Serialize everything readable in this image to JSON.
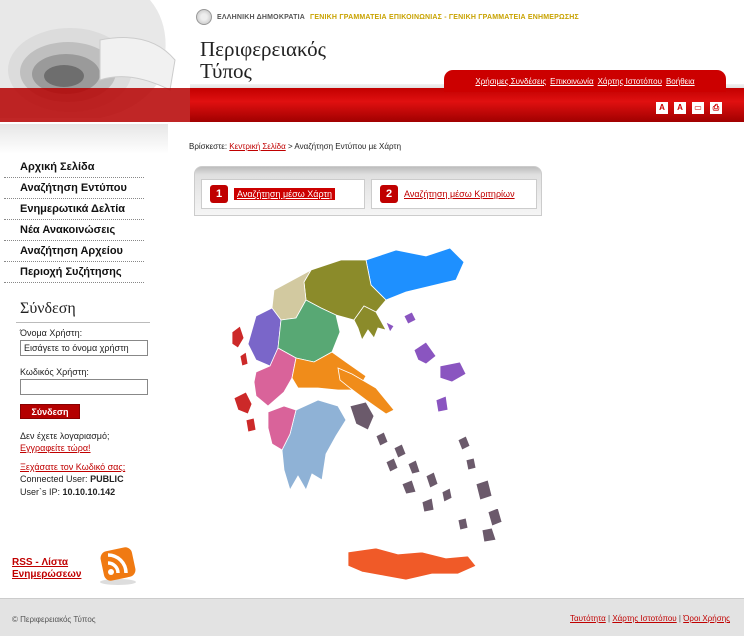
{
  "header": {
    "gov_line_1": "ΕΛΛΗΝΙΚΗ ΔΗΜΟΚΡΑΤΙΑ",
    "gov_line_2": "ΓΕΝΙΚΗ ΓΡΑΜΜΑΤΕΙΑ ΕΠΙΚΟΙΝΩΝΙΑΣ - ΓΕΝΙΚΗ ΓΡΑΜΜΑΤΕΙΑ ΕΝΗΜΕΡΩΣΗΣ",
    "title_line_1": "Περιφερειακός",
    "title_line_2": "Τύπος",
    "top_links": [
      "Χρήσιμες Συνδέσεις",
      "Επικοινωνία",
      "Χάρτης Ιστοτόπου",
      "Βοήθεια"
    ],
    "tools": [
      "A",
      "A",
      "▭",
      "⎙"
    ]
  },
  "sidebar": {
    "menu": [
      "Αρχική Σελίδα",
      "Αναζήτηση Εντύπου",
      "Ενημερωτικά Δελτία",
      "Νέα Ανακοινώσεις",
      "Αναζήτηση Αρχείου",
      "Περιοχή Συζήτησης"
    ],
    "login": {
      "title": "Σύνδεση",
      "username_label": "Όνομα Χρήστη:",
      "username_value": "Εισάγετε το όνομα χρήστη",
      "password_label": "Κωδικός Χρήστη:",
      "password_value": "",
      "button": "Σύνδεση",
      "no_account": "Δεν έχετε λογαριασμό;",
      "register": "Εγγραφείτε τώρα!",
      "forgot": "Ξεχάσατε τον Κωδικό σας;",
      "connected_label": "Connected User:",
      "connected_value": "PUBLIC",
      "ip_label": "User`s IP:",
      "ip_value": "10.10.10.142"
    },
    "rss_line_1": "RSS - Λίστα",
    "rss_line_2": "Ενημερώσεων"
  },
  "main": {
    "breadcrumb_prefix": "Βρίσκεστε:",
    "breadcrumb_home": "Κεντρική Σελίδα",
    "breadcrumb_current": "> Αναζήτηση Εντύπου με Χάρτη",
    "tabs": [
      {
        "number": "1",
        "label": "Αναζήτηση μέσω Χάρτη"
      },
      {
        "number": "2",
        "label": "Αναζήτηση μέσω Κριτηρίων"
      }
    ]
  },
  "colors": {
    "brand_red": "#c00000",
    "region_colors": [
      "#1e90ff",
      "#8b8b2a",
      "#d2c9a0",
      "#7a66c9",
      "#58a874",
      "#cc2929",
      "#d9639a",
      "#f08c1a",
      "#8fb2d6",
      "#6b5a6b",
      "#8a55c0",
      "#f05a28"
    ]
  },
  "footer": {
    "copyright": "© Περιφερειακός Τύπος",
    "links": [
      "Ταυτότητα",
      "Χάρτης Ιστοτόπου",
      "Όροι Χρήσης"
    ]
  }
}
